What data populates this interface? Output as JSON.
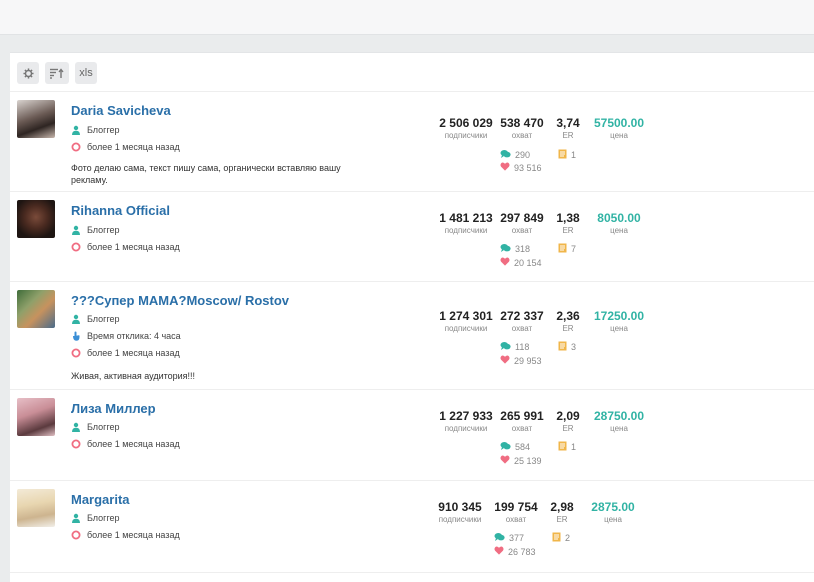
{
  "toolbar": {
    "settings_icon": "gear-icon",
    "sort_icon": "sort-icon",
    "xls_label": "xls"
  },
  "colors": {
    "name": "#2a6fa8",
    "price": "#31b3a4",
    "comment": "#31b3a4",
    "like": "#f06d82",
    "post": "#f0b64a",
    "status": "#f06d82"
  },
  "labels": {
    "subscribers": "подписчики",
    "reach": "охват",
    "er": "ER",
    "price": "цена"
  },
  "bloggers": [
    {
      "name": "Daria Savicheva",
      "role": "Блоггер",
      "last_seen": "более 1 месяца назад",
      "response_time": "",
      "description": "Фото делаю сама, текст пишу сама, органически вставляю вашу рекламу.",
      "subscribers": "2 506 029",
      "reach": "538 470",
      "er": "3,74",
      "price": "57500.00",
      "comments": "290",
      "likes": "93 516",
      "posts": "1"
    },
    {
      "name": "Rihanna Official",
      "role": "Блоггер",
      "last_seen": "более 1 месяца назад",
      "response_time": "",
      "description": "",
      "subscribers": "1 481 213",
      "reach": "297 849",
      "er": "1,38",
      "price": "8050.00",
      "comments": "318",
      "likes": "20 154",
      "posts": "7"
    },
    {
      "name": "???Супер МАМА?Moscow/ Rostov",
      "role": "Блоггер",
      "last_seen": "более 1 месяца назад",
      "response_time": "Время отклика: 4 часа",
      "description": "Живая, активная аудитория!!!",
      "subscribers": "1 274 301",
      "reach": "272 337",
      "er": "2,36",
      "price": "17250.00",
      "comments": "118",
      "likes": "29 953",
      "posts": "3"
    },
    {
      "name": "Лиза Миллер",
      "role": "Блоггер",
      "last_seen": "более 1 месяца назад",
      "response_time": "",
      "description": "",
      "subscribers": "1 227 933",
      "reach": "265 991",
      "er": "2,09",
      "price": "28750.00",
      "comments": "584",
      "likes": "25 139",
      "posts": "1"
    },
    {
      "name": "Margarita",
      "role": "Блоггер",
      "last_seen": "более 1 месяца назад",
      "response_time": "",
      "description": "",
      "subscribers": "910 345",
      "reach": "199 754",
      "er": "2,98",
      "price": "2875.00",
      "comments": "377",
      "likes": "26 783",
      "posts": "2"
    }
  ]
}
